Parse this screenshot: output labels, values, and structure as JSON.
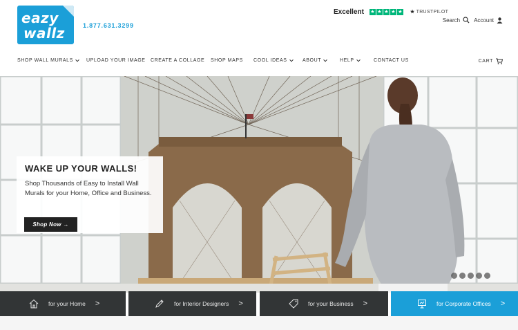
{
  "brand": {
    "logo_line1": "eazy",
    "logo_line2": "wallz",
    "phone": "1.877.631.3299",
    "accent_color": "#1b9fd8"
  },
  "trustpilot": {
    "rating_text": "Excellent",
    "stars": 5,
    "star_glyph": "★",
    "logo_prefix": "★",
    "logo_text": "TRUSTPILOT"
  },
  "utility": {
    "search_label": "Search",
    "account_label": "Account"
  },
  "nav": {
    "items": [
      {
        "label": "SHOP WALL MURALS",
        "dropdown": true
      },
      {
        "label": "UPLOAD YOUR IMAGE",
        "dropdown": false
      },
      {
        "label": "CREATE A COLLAGE",
        "dropdown": false
      },
      {
        "label": "SHOP MAPS",
        "dropdown": false
      },
      {
        "label": "COOL IDEAS",
        "dropdown": true
      },
      {
        "label": "ABOUT",
        "dropdown": true
      },
      {
        "label": "HELP",
        "dropdown": true
      },
      {
        "label": "CONTACT US",
        "dropdown": false
      }
    ],
    "cart_label": "CART"
  },
  "hero": {
    "heading": "WAKE UP YOUR WALLS!",
    "body": "Shop Thousands of Easy to Install Wall Murals for your Home, Office and Business.",
    "cta_label": "Shop Now →",
    "slide_count": 5,
    "active_slide": 1
  },
  "tiles": [
    {
      "label": "for your Home",
      "icon": "house-icon",
      "arrow": ">",
      "highlight": false
    },
    {
      "label": "for Interior Designers",
      "icon": "pencil-icon",
      "arrow": ">",
      "highlight": false
    },
    {
      "label": "for your Business",
      "icon": "tag-icon",
      "arrow": ">",
      "highlight": false
    },
    {
      "label": "for Corporate Offices",
      "icon": "presentation-icon",
      "arrow": ">",
      "highlight": true
    }
  ]
}
